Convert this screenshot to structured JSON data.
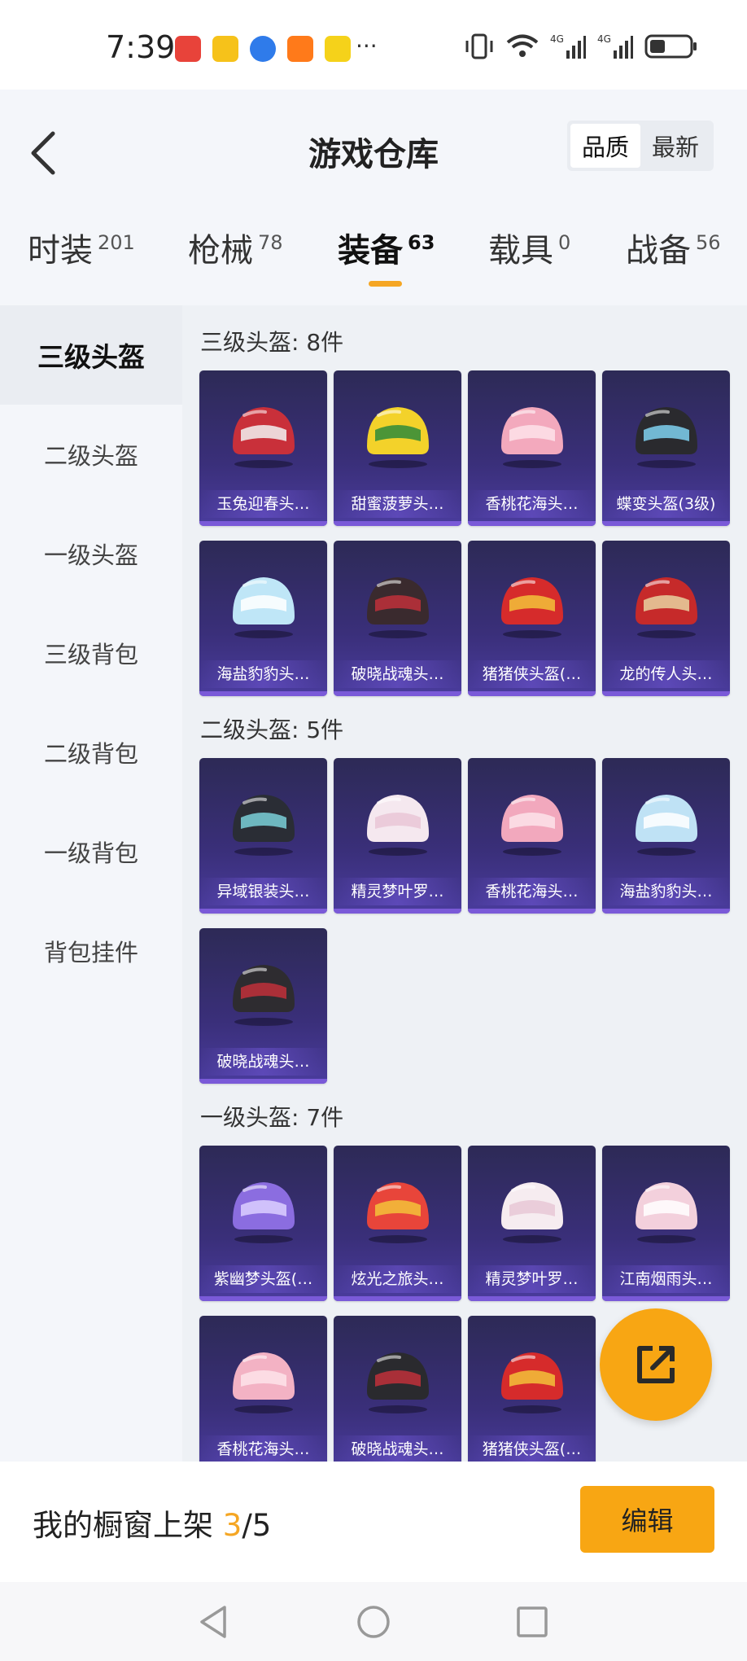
{
  "status_bar": {
    "time": "7:39",
    "more": "···",
    "app_colors": [
      "#e8433a",
      "#f6c21a",
      "#2f7bea",
      "#ff7a1a",
      "#f5d21a"
    ]
  },
  "header": {
    "title": "游戏仓库",
    "sort": [
      {
        "label": "品质",
        "active": true
      },
      {
        "label": "最新",
        "active": false
      }
    ]
  },
  "tabs": [
    {
      "label": "时装",
      "count": "201"
    },
    {
      "label": "枪械",
      "count": "78"
    },
    {
      "label": "装备",
      "count": "63"
    },
    {
      "label": "载具",
      "count": "0"
    },
    {
      "label": "战备",
      "count": "56"
    }
  ],
  "sidebar": [
    {
      "label": "三级头盔"
    },
    {
      "label": "二级头盔"
    },
    {
      "label": "一级头盔"
    },
    {
      "label": "三级背包"
    },
    {
      "label": "二级背包"
    },
    {
      "label": "一级背包"
    },
    {
      "label": "背包挂件"
    }
  ],
  "sections": [
    {
      "title": "三级头盔: 8件",
      "items": [
        {
          "name": "玉兔迎春头…",
          "color": "#c9303a",
          "accent": "#f2f2f2"
        },
        {
          "name": "甜蜜菠萝头…",
          "color": "#f3d22a",
          "accent": "#2e8b3a"
        },
        {
          "name": "香桃花海头…",
          "color": "#f3a9bd",
          "accent": "#fde3ea"
        },
        {
          "name": "蝶变头盔(3级)",
          "color": "#2a2a2e",
          "accent": "#7fd1f0"
        },
        {
          "name": "海盐豹豹头…",
          "color": "#bfe6f7",
          "accent": "#ffffff"
        },
        {
          "name": "破晓战魂头…",
          "color": "#3a2a2e",
          "accent": "#c0303a"
        },
        {
          "name": "猪猪侠头盔(…",
          "color": "#d62b2b",
          "accent": "#f3c23a"
        },
        {
          "name": "龙的传人头…",
          "color": "#c62a2a",
          "accent": "#e8d2a0"
        }
      ]
    },
    {
      "title": "二级头盔: 5件",
      "items": [
        {
          "name": "异域银装头…",
          "color": "#2a2d35",
          "accent": "#7ad0d8"
        },
        {
          "name": "精灵梦叶罗…",
          "color": "#f5e8ef",
          "accent": "#e9c5d6"
        },
        {
          "name": "香桃花海头…",
          "color": "#f2a8bd",
          "accent": "#fde3ea"
        },
        {
          "name": "海盐豹豹头…",
          "color": "#bfe2f5",
          "accent": "#ffffff"
        },
        {
          "name": "破晓战魂头…",
          "color": "#2e2c30",
          "accent": "#c0303a"
        }
      ]
    },
    {
      "title": "一级头盔: 7件",
      "items": [
        {
          "name": "紫幽梦头盔(…",
          "color": "#8b6de0",
          "accent": "#dcd0ff"
        },
        {
          "name": "炫光之旅头…",
          "color": "#e8453a",
          "accent": "#f3c23a"
        },
        {
          "name": "精灵梦叶罗…",
          "color": "#f6ecf0",
          "accent": "#e8c8d6"
        },
        {
          "name": "江南烟雨头…",
          "color": "#f3d0dc",
          "accent": "#ffffff"
        },
        {
          "name": "香桃花海头…",
          "color": "#f3b2c4",
          "accent": "#fde3ea"
        },
        {
          "name": "破晓战魂头…",
          "color": "#2a2a2e",
          "accent": "#c0303a"
        },
        {
          "name": "猪猪侠头盔(…",
          "color": "#d62b2b",
          "accent": "#f3c23a"
        }
      ]
    }
  ],
  "bottom": {
    "showcase_label": "我的橱窗上架",
    "showcase_current": "3",
    "showcase_total": "/5",
    "edit_label": "编辑"
  },
  "accent_color": "#f5a623"
}
